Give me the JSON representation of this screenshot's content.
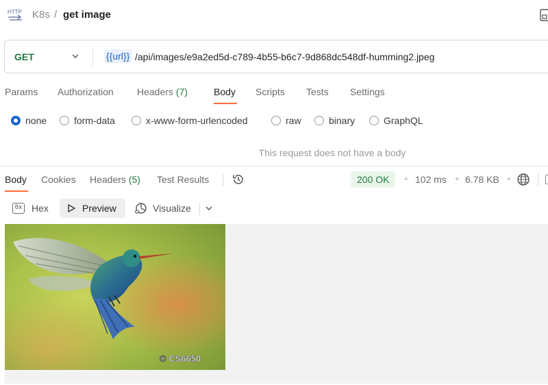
{
  "header": {
    "collection": "K8s",
    "separator": "/",
    "request_name": "get image"
  },
  "request": {
    "method": "GET",
    "url_variable": "{{url}}",
    "url_path": "/api/images/e9a2ed5d-c789-4b55-b6c7-9d868dc548df-humming2.jpeg"
  },
  "request_tabs": [
    {
      "label": "Params"
    },
    {
      "label": "Authorization"
    },
    {
      "label": "Headers",
      "count": "(7)"
    },
    {
      "label": "Body",
      "active": true
    },
    {
      "label": "Scripts"
    },
    {
      "label": "Tests"
    },
    {
      "label": "Settings"
    }
  ],
  "body_types": [
    {
      "label": "none",
      "checked": true
    },
    {
      "label": "form-data"
    },
    {
      "label": "x-www-form-urlencoded"
    },
    {
      "label": "raw"
    },
    {
      "label": "binary"
    },
    {
      "label": "GraphQL"
    }
  ],
  "no_body_message": "This request does not have a body",
  "response_tabs": [
    {
      "label": "Body",
      "active": true
    },
    {
      "label": "Cookies"
    },
    {
      "label": "Headers",
      "count": "(5)"
    },
    {
      "label": "Test Results"
    }
  ],
  "response_meta": {
    "status": "200 OK",
    "time": "102 ms",
    "size": "6.78 KB"
  },
  "view_modes": {
    "hex": "Hex",
    "hex_icon": "0x",
    "preview": "Preview",
    "visualize": "Visualize"
  },
  "preview_image": {
    "subject": "hummingbird photo",
    "watermark": "© CS6650"
  },
  "colors": {
    "accent_tab": "#ff6c37",
    "method_green": "#1f7a3d",
    "status_green": "#1f7a3d",
    "variable_blue": "#1a64c8"
  },
  "icons": {
    "http": "http-icon",
    "save": "save-icon",
    "history": "history-icon",
    "globe": "globe-icon",
    "play": "play-icon",
    "visualize": "visualize-icon"
  }
}
